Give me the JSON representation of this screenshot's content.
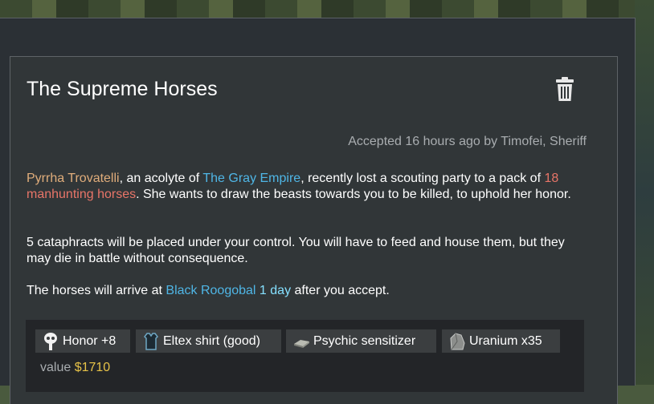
{
  "quest": {
    "title": "The Supreme Horses",
    "accepted": "Accepted 16 hours ago by Timofei, Sheriff",
    "description": {
      "p1": {
        "name": "Pyrrha Trovatelli",
        "t1": ", an acolyte of ",
        "faction": "The Gray Empire",
        "t2": ", recently lost a scouting party to a pack of ",
        "threat": "18 manhunting horses",
        "t3": ". She wants to draw the beasts towards you to be killed, to uphold her honor."
      },
      "p2": "5 cataphracts will be placed under your control. You will have to feed and house them, but they may die in battle without consequence.",
      "p3": {
        "t1": "The horses will arrive at ",
        "place": "Black Roogobal",
        "t2": " ",
        "time": "1 day",
        "t3": " after you accept."
      }
    },
    "rewards": [
      {
        "label": "Honor +8",
        "icon": "honor-icon"
      },
      {
        "label": "Eltex shirt (good)",
        "icon": "shirt-icon"
      },
      {
        "label": "Psychic sensitizer",
        "icon": "sensitizer-icon"
      },
      {
        "label": "Uranium x35",
        "icon": "uranium-icon"
      }
    ],
    "value_label": "value ",
    "value_amount": "$1710"
  },
  "colors": {
    "panel_bg": "#313638",
    "rewards_bg": "#232528",
    "pawn_name": "#e0ad7b",
    "faction": "#4fb6e6",
    "threat": "#e87568",
    "time": "#85e0ff",
    "value": "#e6c248"
  }
}
